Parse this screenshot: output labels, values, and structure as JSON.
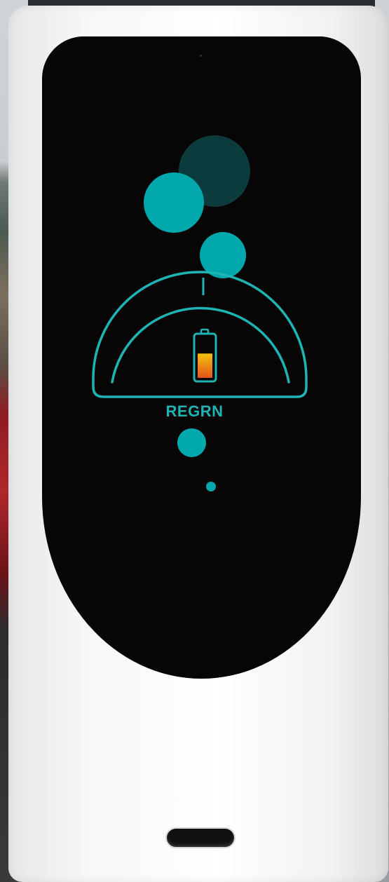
{
  "display": {
    "mode_label": "REGRN",
    "battery_level": 0.6
  },
  "colors": {
    "accent": "#00a8ad",
    "accent_dark": "#0b3b3c",
    "screen": "#070506",
    "body": "#ffffff",
    "battery_top": "#f4c20d",
    "battery_bottom": "#e4521b"
  },
  "icons": [
    "battery-icon"
  ]
}
